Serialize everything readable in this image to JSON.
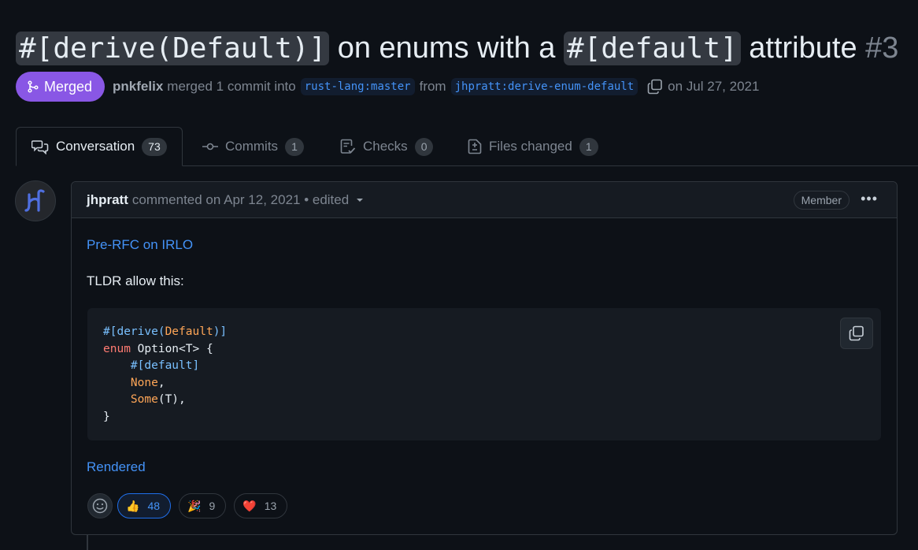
{
  "pr": {
    "title_code_1": "#[derive(Default)]",
    "title_text_1": " on enums with a ",
    "title_code_2": "#[default]",
    "title_text_2": " attribute ",
    "title_number": "#3",
    "state_label": "Merged",
    "merged_by": "pnkfelix",
    "merge_text": "merged 1 commit into",
    "base_branch": "rust-lang:master",
    "from_text": "from",
    "head_branch": "jhpratt:derive-enum-default",
    "date_text": "on Jul 27, 2021"
  },
  "tabs": [
    {
      "label": "Conversation",
      "count": "73",
      "icon": "comment-discussion-icon"
    },
    {
      "label": "Commits",
      "count": "1",
      "icon": "commit-icon"
    },
    {
      "label": "Checks",
      "count": "0",
      "icon": "checklist-icon"
    },
    {
      "label": "Files changed",
      "count": "1",
      "icon": "diff-icon"
    }
  ],
  "comment": {
    "author": "jhpratt",
    "action_text": "commented on Apr 12, 2021 • edited",
    "role_badge": "Member",
    "link_1": "Pre-RFC on IRLO",
    "paragraph": "TLDR allow this:",
    "code_lines": [
      "#[derive(Default)]",
      "enum Option<T> {",
      "    #[default]",
      "    None,",
      "    Some(T),",
      "}"
    ],
    "link_2": "Rendered"
  },
  "reactions": [
    {
      "emoji": "👍",
      "name": "thumbs-up",
      "count": "48",
      "active": true
    },
    {
      "emoji": "🎉",
      "name": "hooray",
      "count": "9",
      "active": false
    },
    {
      "emoji": "❤️",
      "name": "heart",
      "count": "13",
      "active": false
    }
  ],
  "colors": {
    "background": "#0d1117",
    "merged": "#8957e5",
    "link": "#4493f8",
    "border": "#30363d"
  }
}
